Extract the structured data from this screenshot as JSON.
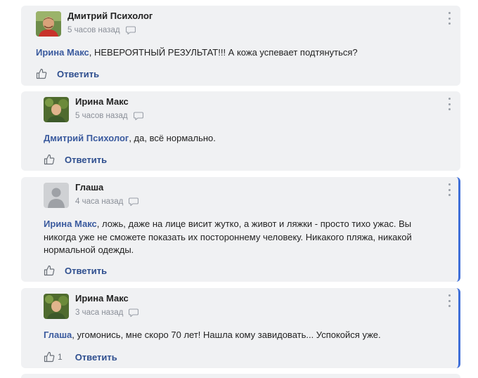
{
  "comments": [
    {
      "author": "Дмитрий Психолог",
      "time": "5 часов назад",
      "mention": "Ирина Макс",
      "body": ", НЕВЕРОЯТНЫЙ РЕЗУЛЬТАТ!!! А кожа успевает подтянуться?",
      "reply_label": "Ответить",
      "likes": ""
    },
    {
      "author": "Ирина Макс",
      "time": "5 часов назад",
      "mention": "Дмитрий Психолог",
      "body": ", да, всё нормально.",
      "reply_label": "Ответить",
      "likes": ""
    },
    {
      "author": "Глаша",
      "time": "4 часа назад",
      "mention": "Ирина Макс",
      "body": ", ложь, даже на лице висит жутко, а живот и ляжки - просто тихо ужас. Вы никогда уже не сможете показать их постороннему человеку. Никакого пляжа, никакой нормальной одежды.",
      "reply_label": "Ответить",
      "likes": ""
    },
    {
      "author": "Ирина Макс",
      "time": "3 часа назад",
      "mention": "Глаша",
      "body": ", угомонись, мне скоро 70 лет! Нашла кому завидовать... Успокойся уже.",
      "reply_label": "Ответить",
      "likes": "1"
    }
  ],
  "colors": {
    "card_bg": "#f0f1f3",
    "accent": "#3f6fd8",
    "mention": "#3a5a9e",
    "reply": "#2f4f8f",
    "meta": "#8a8f98"
  },
  "icons": {
    "like": "thumbs-up-icon",
    "comment": "speech-bubble-icon",
    "menu": "kebab-menu-icon"
  }
}
